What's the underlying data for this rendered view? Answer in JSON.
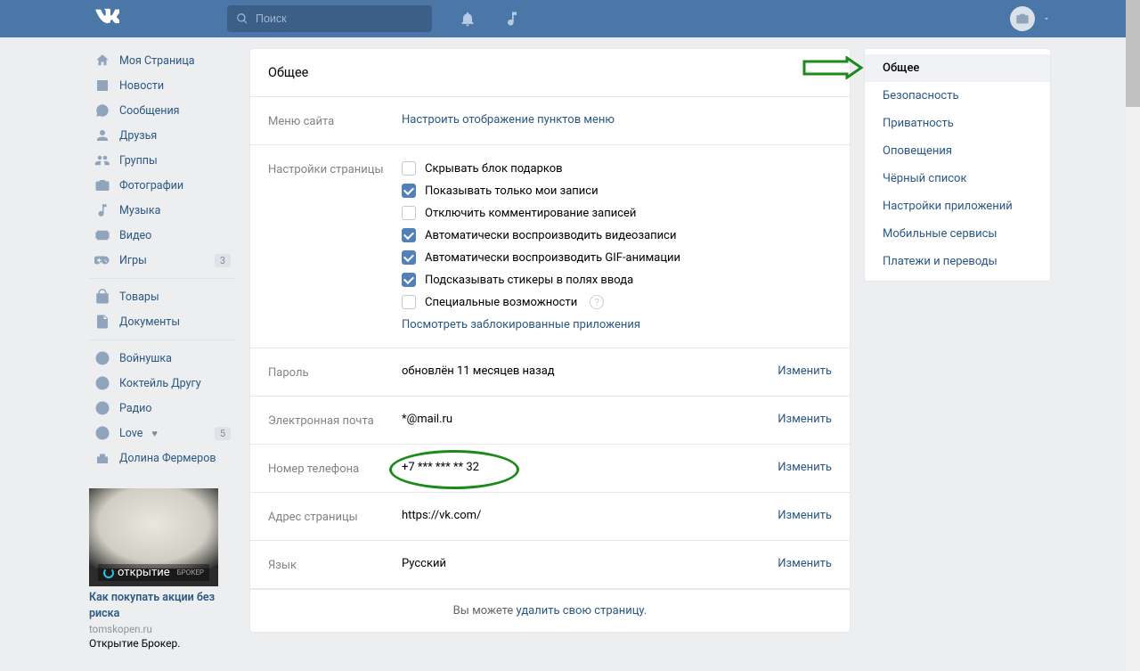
{
  "search_placeholder": "Поиск",
  "user_name": "",
  "left_nav": {
    "items": [
      {
        "label": "Моя Страница"
      },
      {
        "label": "Новости"
      },
      {
        "label": "Сообщения"
      },
      {
        "label": "Друзья"
      },
      {
        "label": "Группы"
      },
      {
        "label": "Фотографии"
      },
      {
        "label": "Музыка"
      },
      {
        "label": "Видео"
      },
      {
        "label": "Игры",
        "count": "3"
      }
    ],
    "items2": [
      {
        "label": "Товары"
      },
      {
        "label": "Документы"
      }
    ],
    "items3": [
      {
        "label": "Войнушка"
      },
      {
        "label": "Коктейль Другу"
      },
      {
        "label": "Радио"
      },
      {
        "label": "Love",
        "heart": "♥",
        "count": "5"
      },
      {
        "label": "Долина Фермеров"
      }
    ]
  },
  "ad": {
    "brand": "открытие",
    "brand_sub": "БРОКЕР",
    "title": "Как покупать акции без риска",
    "domain": "tomskopen.ru",
    "text": "Открытие Брокер."
  },
  "settings": {
    "title": "Общее",
    "menu": {
      "label": "Меню сайта",
      "link": "Настроить отображение пунктов меню"
    },
    "page": {
      "label": "Настройки страницы",
      "opts": [
        {
          "on": false,
          "label": "Скрывать блок подарков"
        },
        {
          "on": true,
          "label": "Показывать только мои записи"
        },
        {
          "on": false,
          "label": "Отключить комментирование записей"
        },
        {
          "on": true,
          "label": "Автоматически воспроизводить видеозаписи"
        },
        {
          "on": true,
          "label": "Автоматически воспроизводить GIF-анимации"
        },
        {
          "on": true,
          "label": "Подсказывать стикеры в полях ввода"
        },
        {
          "on": false,
          "label": "Специальные возможности",
          "help": true
        }
      ],
      "blocked_link": "Посмотреть заблокированные приложения"
    },
    "password": {
      "label": "Пароль",
      "value": "обновлён 11 месяцев назад",
      "edit": "Изменить"
    },
    "email": {
      "label": "Электронная почта",
      "value": "*@mail.ru",
      "edit": "Изменить"
    },
    "phone": {
      "label": "Номер телефона",
      "value": "+7 *** *** ** 32",
      "edit": "Изменить"
    },
    "addr": {
      "label": "Адрес страницы",
      "value": "https://vk.com/",
      "edit": "Изменить"
    },
    "lang": {
      "label": "Язык",
      "value": "Русский",
      "edit": "Изменить"
    },
    "footer_pre": "Вы можете ",
    "footer_link": "удалить свою страницу."
  },
  "right_nav": {
    "items": [
      "Общее",
      "Безопасность",
      "Приватность",
      "Оповещения",
      "Чёрный список",
      "Настройки приложений",
      "Мобильные сервисы",
      "Платежи и переводы"
    ]
  }
}
